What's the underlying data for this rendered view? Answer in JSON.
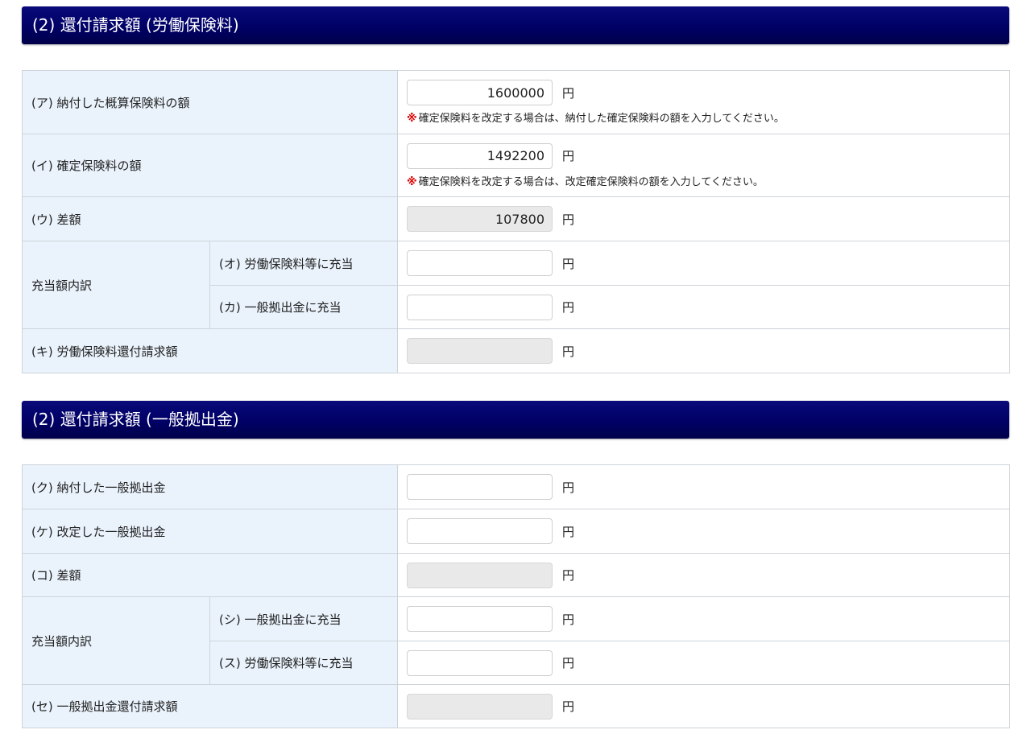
{
  "section1": {
    "title": "(2) 還付請求額 (労働保険料)",
    "rows": {
      "a": {
        "label": "(ア) 納付した概算保険料の額",
        "value": "1600000",
        "unit": "円",
        "note_mark": "※",
        "note": "確定保険料を改定する場合は、納付した確定保険料の額を入力してください。"
      },
      "i": {
        "label": "(イ) 確定保険料の額",
        "value": "1492200",
        "unit": "円",
        "note_mark": "※",
        "note": "確定保険料を改定する場合は、改定確定保険料の額を入力してください。"
      },
      "u": {
        "label": "(ウ) 差額",
        "value": "107800",
        "unit": "円"
      },
      "group_label": "充当額内訳",
      "o": {
        "label": "(オ) 労働保険料等に充当",
        "value": "",
        "unit": "円"
      },
      "ka": {
        "label": "(カ) 一般拠出金に充当",
        "value": "",
        "unit": "円"
      },
      "ki": {
        "label": "(キ) 労働保険料還付請求額",
        "value": "",
        "unit": "円"
      }
    }
  },
  "section2": {
    "title": "(2) 還付請求額 (一般拠出金)",
    "rows": {
      "ku": {
        "label": "(ク) 納付した一般拠出金",
        "value": "",
        "unit": "円"
      },
      "ke": {
        "label": "(ケ) 改定した一般拠出金",
        "value": "",
        "unit": "円"
      },
      "ko": {
        "label": "(コ) 差額",
        "value": "",
        "unit": "円"
      },
      "group_label": "充当額内訳",
      "shi": {
        "label": "(シ) 一般拠出金に充当",
        "value": "",
        "unit": "円"
      },
      "su": {
        "label": "(ス) 労働保険料等に充当",
        "value": "",
        "unit": "円"
      },
      "se": {
        "label": "(セ) 一般拠出金還付請求額",
        "value": "",
        "unit": "円"
      }
    }
  },
  "colors": {
    "header_bg": "#000066",
    "label_bg": "#eaf3fc",
    "note_mark": "#e00000",
    "readonly_bg": "#e9e9e9"
  }
}
